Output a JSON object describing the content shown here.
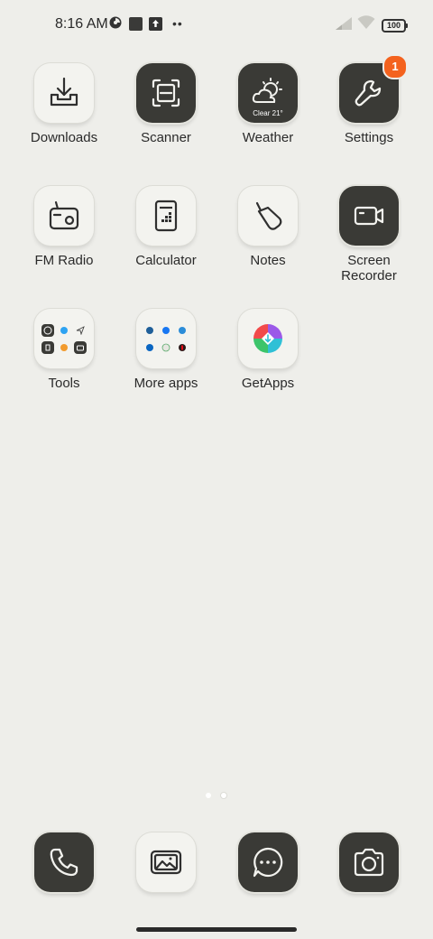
{
  "status_bar": {
    "time": "8:16 AM",
    "battery": "100",
    "icons": [
      "data-saver-icon",
      "square-notification-icon",
      "upload-icon",
      "more-dots-icon",
      "signal-icon",
      "wifi-icon",
      "battery-icon"
    ]
  },
  "apps": [
    {
      "name": "Downloads",
      "icon": "download-icon"
    },
    {
      "name": "Scanner",
      "icon": "scanner-icon"
    },
    {
      "name": "Weather",
      "icon": "weather-icon",
      "temp": "Clear 21°"
    },
    {
      "name": "Settings",
      "icon": "wrench-icon",
      "badge": "1"
    },
    {
      "name": "FM Radio",
      "icon": "radio-icon"
    },
    {
      "name": "Calculator",
      "icon": "calculator-icon"
    },
    {
      "name": "Notes",
      "icon": "notes-icon"
    },
    {
      "name": "Screen\nRecorder",
      "icon": "video-camera-icon"
    },
    {
      "name": "Tools",
      "icon": "folder-icon"
    },
    {
      "name": "More apps",
      "icon": "folder-icon"
    },
    {
      "name": "GetApps",
      "icon": "getapps-icon"
    }
  ],
  "dock": [
    {
      "icon": "phone-icon"
    },
    {
      "icon": "gallery-icon"
    },
    {
      "icon": "messages-icon"
    },
    {
      "icon": "camera-icon"
    }
  ],
  "colors": {
    "background": "#eeeeea",
    "dark_icon": "#3a3a36",
    "light_icon": "#f3f3ef",
    "badge": "#f4621e"
  },
  "page_indicator": {
    "pages": 2,
    "current": 2
  }
}
